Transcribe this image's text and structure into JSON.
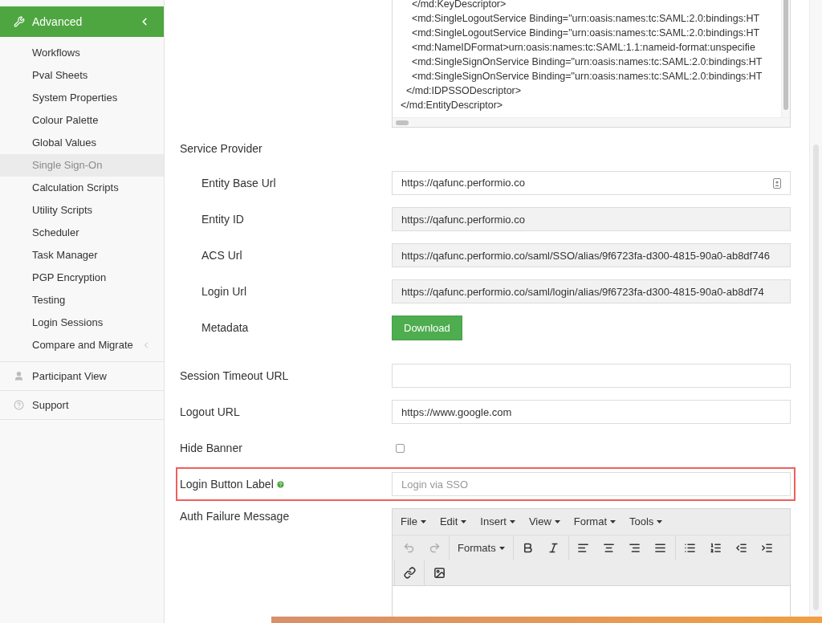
{
  "sidebar": {
    "section": {
      "label": "Advanced",
      "expanded": true
    },
    "items": [
      {
        "label": "Workflows",
        "selected": false,
        "kind": "link"
      },
      {
        "label": "Pval Sheets",
        "selected": false,
        "kind": "link"
      },
      {
        "label": "System Properties",
        "selected": false,
        "kind": "link"
      },
      {
        "label": "Colour Palette",
        "selected": false,
        "kind": "link"
      },
      {
        "label": "Global Values",
        "selected": false,
        "kind": "link"
      },
      {
        "label": "Single Sign-On",
        "selected": true,
        "kind": "link"
      },
      {
        "label": "Calculation Scripts",
        "selected": false,
        "kind": "link"
      },
      {
        "label": "Utility Scripts",
        "selected": false,
        "kind": "link"
      },
      {
        "label": "Scheduler",
        "selected": false,
        "kind": "link"
      },
      {
        "label": "Task Manager",
        "selected": false,
        "kind": "link"
      },
      {
        "label": "PGP Encryption",
        "selected": false,
        "kind": "link"
      },
      {
        "label": "Testing",
        "selected": false,
        "kind": "link"
      },
      {
        "label": "Login Sessions",
        "selected": false,
        "kind": "link"
      },
      {
        "label": "Compare and Migrate",
        "selected": false,
        "kind": "submenu"
      }
    ],
    "bottom_items": [
      {
        "label": "Participant View",
        "kind": "participant"
      },
      {
        "label": "Support",
        "kind": "help"
      }
    ]
  },
  "metadata_xml": {
    "lines": [
      "    </md:KeyDescriptor>",
      "    <md:SingleLogoutService Binding=\"urn:oasis:names:tc:SAML:2.0:bindings:HT",
      "    <md:SingleLogoutService Binding=\"urn:oasis:names:tc:SAML:2.0:bindings:HT",
      "    <md:NameIDFormat>urn:oasis:names:tc:SAML:1.1:nameid-format:unspecifie",
      "    <md:SingleSignOnService Binding=\"urn:oasis:names:tc:SAML:2.0:bindings:HT",
      "    <md:SingleSignOnService Binding=\"urn:oasis:names:tc:SAML:2.0:bindings:HT",
      "  </md:IDPSSODescriptor>",
      "</md:EntityDescriptor>"
    ]
  },
  "service_provider": {
    "heading": "Service Provider",
    "fields": [
      {
        "label": "Entity Base Url",
        "kind": "text",
        "value": "https://qafunc.performio.co"
      },
      {
        "label": "Entity ID",
        "kind": "readonly",
        "value": "https://qafunc.performio.co"
      },
      {
        "label": "ACS Url",
        "kind": "readonly",
        "value": "https://qafunc.performio.co/saml/SSO/alias/9f6723fa-d300-4815-90a0-ab8df746"
      },
      {
        "label": "Login Url",
        "kind": "readonly",
        "value": "https://qafunc.performio.co/saml/login/alias/9f6723fa-d300-4815-90a0-ab8df74"
      },
      {
        "label": "Metadata",
        "kind": "button",
        "button": "Download"
      }
    ]
  },
  "fields": [
    {
      "label": "Session Timeout URL",
      "kind": "text",
      "help": false,
      "highlighted": false
    },
    {
      "label": "Logout URL",
      "kind": "text",
      "value": "https://www.google.com",
      "help": false,
      "highlighted": false
    },
    {
      "label": "Hide Banner",
      "kind": "checkbox",
      "checked": false,
      "help": false,
      "highlighted": false
    },
    {
      "label": "Login Button Label",
      "kind": "text",
      "placeholder": "Login via SSO",
      "help": true,
      "highlighted": true
    },
    {
      "label": "Auth Failure Message",
      "kind": "editor",
      "help": false,
      "highlighted": false
    }
  ],
  "editor": {
    "menus": [
      "File",
      "Edit",
      "Insert",
      "View",
      "Format",
      "Tools"
    ],
    "toolbar": [
      [
        {
          "kind": "undo",
          "disabled": true
        },
        {
          "kind": "redo",
          "disabled": true
        }
      ],
      [
        {
          "kind": "formats",
          "label": "Formats",
          "disabled": false
        }
      ],
      [
        {
          "kind": "bold",
          "disabled": false
        },
        {
          "kind": "italic",
          "disabled": false
        }
      ],
      [
        {
          "kind": "align-left",
          "disabled": false
        },
        {
          "kind": "align-center",
          "disabled": false
        },
        {
          "kind": "align-right",
          "disabled": false
        },
        {
          "kind": "align-justify",
          "disabled": false
        }
      ],
      [
        {
          "kind": "bullet-list",
          "disabled": false
        },
        {
          "kind": "numbered-list",
          "disabled": false
        },
        {
          "kind": "outdent",
          "disabled": false
        },
        {
          "kind": "indent",
          "disabled": false
        }
      ],
      [
        {
          "kind": "link",
          "disabled": false
        }
      ],
      [
        {
          "kind": "image",
          "disabled": false
        }
      ]
    ]
  }
}
